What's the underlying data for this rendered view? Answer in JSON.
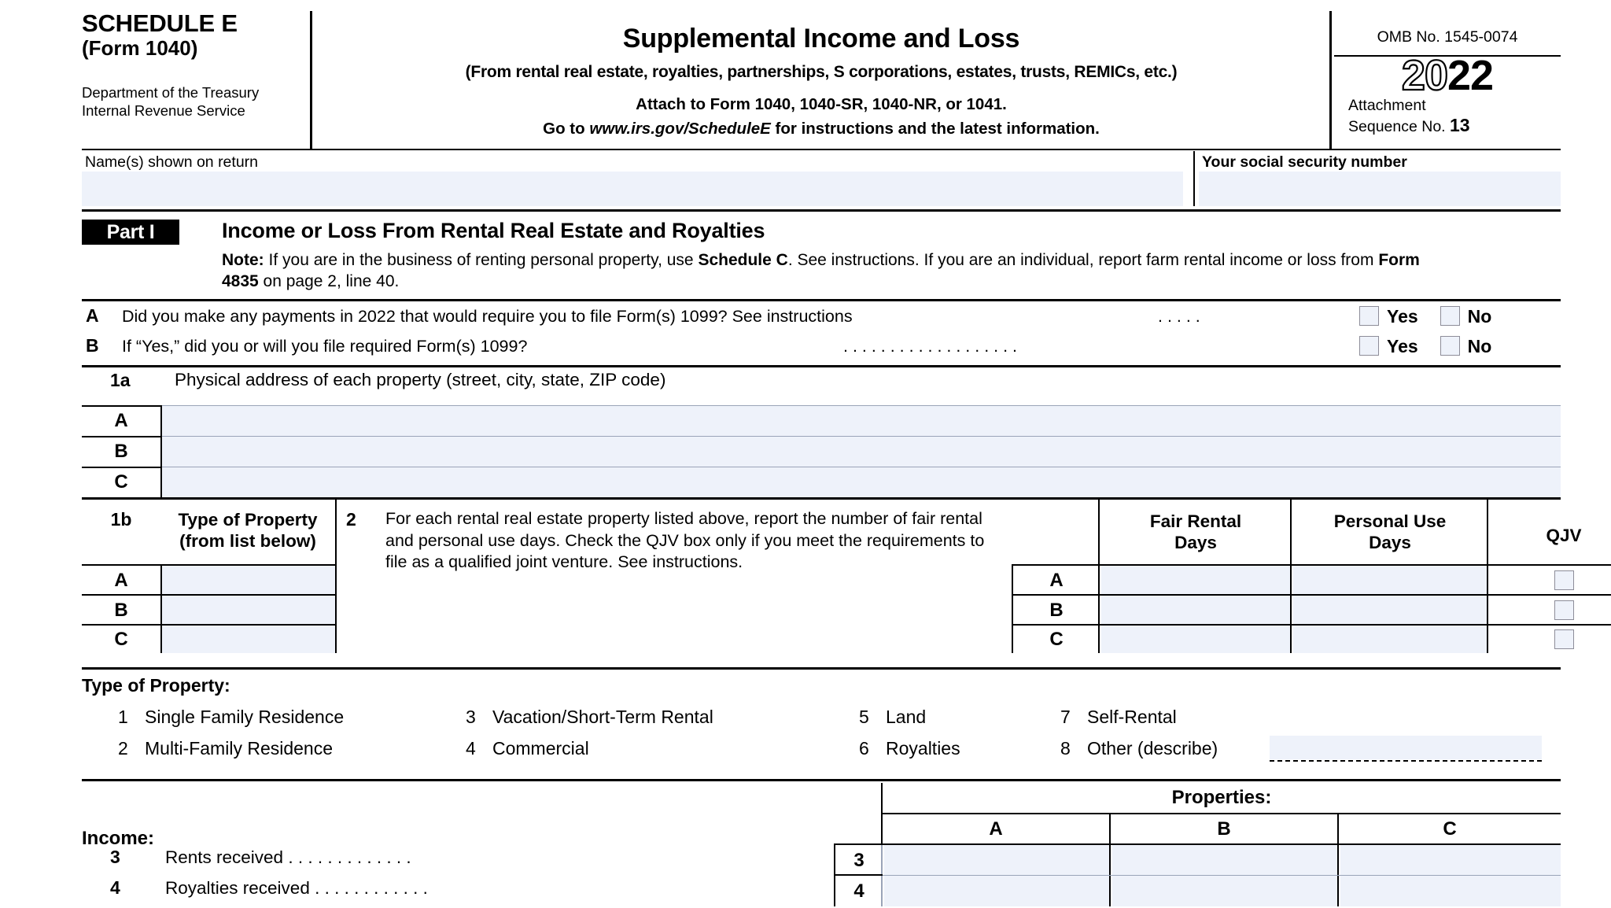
{
  "header": {
    "schedule": "SCHEDULE E",
    "form": "(Form 1040)",
    "dept_line1": "Department of the Treasury",
    "dept_line2": "Internal Revenue Service",
    "title": "Supplemental Income and Loss",
    "subtitle": "(From rental real estate, royalties, partnerships, S corporations, estates, trusts, REMICs, etc.)",
    "attach_to": "Attach to Form 1040, 1040-SR, 1040-NR, or 1041.",
    "goto_prefix": "Go to ",
    "goto_url": "www.irs.gov/ScheduleE",
    "goto_suffix": " for instructions and the latest information.",
    "omb": "OMB No. 1545-0074",
    "year_outline": "20",
    "year_solid": "22",
    "attachment_label_line1": "Attachment",
    "attachment_label_line2": "Sequence No.",
    "attachment_number": "13"
  },
  "identity": {
    "name_label": "Name(s) shown on return",
    "name_value": "",
    "ssn_label": "Your social security number",
    "ssn_value": ""
  },
  "part1": {
    "tag": "Part I",
    "title": "Income or Loss From Rental Real Estate and Royalties",
    "note_bold": "Note:",
    "note_text_1": " If you are in the business of renting personal property, use ",
    "note_bold_2": "Schedule C",
    "note_text_2": ". See instructions. If you are an individual, report farm rental income or loss from ",
    "note_bold_3": "Form 4835",
    "note_text_3": " on page 2, line 40."
  },
  "questions": [
    {
      "letter": "A",
      "text": "Did you make any payments in 2022 that would require you to file Form(s) 1099? See instructions",
      "dots": ".    .    .    .    .",
      "yes_label": "Yes",
      "no_label": "No",
      "yes_checked": false,
      "no_checked": false
    },
    {
      "letter": "B",
      "text": "If “Yes,” did you or will you file required Form(s) 1099?",
      "dots": ".   .   .   .   .   .   .   .   .   .   .   .   .   .   .   .   .   .   .",
      "yes_label": "Yes",
      "no_label": "No",
      "yes_checked": false,
      "no_checked": false
    }
  ],
  "line1a": {
    "number": "1a",
    "label": "Physical address of each property (street, city, state, ZIP code)",
    "rows": [
      {
        "letter": "A",
        "value": ""
      },
      {
        "letter": "B",
        "value": ""
      },
      {
        "letter": "C",
        "value": ""
      }
    ]
  },
  "line1b": {
    "number": "1b",
    "header_line1": "Type of Property",
    "header_line2": "(from list below)",
    "rows": [
      {
        "letter": "A",
        "value": ""
      },
      {
        "letter": "B",
        "value": ""
      },
      {
        "letter": "C",
        "value": ""
      }
    ]
  },
  "line2": {
    "number": "2",
    "text": "For each rental real estate property listed above, report the number of fair rental and personal use days. Check the QJV box only if you meet the requirements to file as a qualified joint venture. See instructions.",
    "col_fair_rental_line1": "Fair Rental",
    "col_fair_rental_line2": "Days",
    "col_personal_use_line1": "Personal Use",
    "col_personal_use_line2": "Days",
    "col_qjv": "QJV",
    "rows": [
      {
        "letter": "A",
        "fair_rental_days": "",
        "personal_use_days": "",
        "qjv_checked": false
      },
      {
        "letter": "B",
        "fair_rental_days": "",
        "personal_use_days": "",
        "qjv_checked": false
      },
      {
        "letter": "C",
        "fair_rental_days": "",
        "personal_use_days": "",
        "qjv_checked": false
      }
    ]
  },
  "type_of_property": {
    "heading": "Type of Property:",
    "items": [
      {
        "num": "1",
        "label": "Single Family Residence"
      },
      {
        "num": "2",
        "label": "Multi-Family Residence"
      },
      {
        "num": "3",
        "label": "Vacation/Short-Term Rental"
      },
      {
        "num": "4",
        "label": "Commercial"
      },
      {
        "num": "5",
        "label": "Land"
      },
      {
        "num": "6",
        "label": "Royalties"
      },
      {
        "num": "7",
        "label": "Self-Rental"
      },
      {
        "num": "8",
        "label": "Other (describe)"
      }
    ],
    "other_value": ""
  },
  "income": {
    "heading": "Income:",
    "properties_header": "Properties:",
    "property_columns": [
      "A",
      "B",
      "C"
    ],
    "rows": [
      {
        "number": "3",
        "label": "Rents received",
        "dots": ".    .    .    .    .    .    .    .    .    .    .    .    .",
        "values": [
          "",
          "",
          ""
        ]
      },
      {
        "number": "4",
        "label": "Royalties received",
        "dots": ".    .    .    .    .    .    .    .    .    .    .    .",
        "values": [
          "",
          "",
          ""
        ]
      }
    ]
  },
  "colors": {
    "field_fill": "#eef2fa",
    "rule": "#000000",
    "checkbox_border": "#8d8d99"
  }
}
